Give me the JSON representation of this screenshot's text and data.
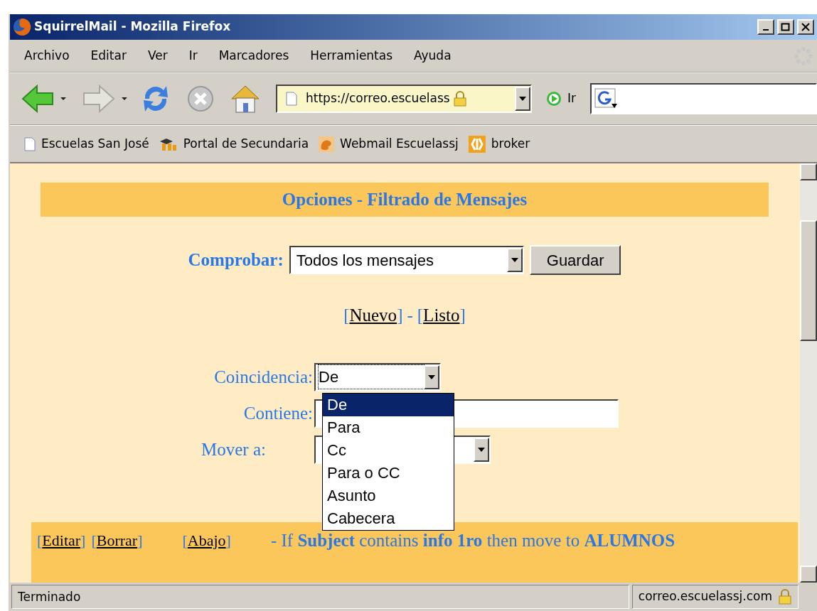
{
  "window": {
    "title": "SquirrelMail - Mozilla Firefox"
  },
  "menu": [
    "Archivo",
    "Editar",
    "Ver",
    "Ir",
    "Marcadores",
    "Herramientas",
    "Ayuda"
  ],
  "toolbar": {
    "url": "https://correo.escuelass",
    "go": "Ir"
  },
  "bookmarks": [
    {
      "label": "Escuelas San José",
      "kind": "page"
    },
    {
      "label": "Portal de Secundaria",
      "kind": "portal"
    },
    {
      "label": "Webmail Escuelassj",
      "kind": "webmail"
    },
    {
      "label": "broker",
      "kind": "broker"
    }
  ],
  "page": {
    "heading": "Opciones - Filtrado de Mensajes",
    "check": {
      "label": "Comprobar:",
      "value": "Todos los mensajes",
      "button": "Guardar"
    },
    "links": [
      {
        "open": "[",
        "label": "Nuevo",
        "close": "]"
      },
      {
        "open": "[",
        "label": "Listo",
        "close": "]"
      }
    ],
    "link_sep": "-",
    "form": {
      "match_label": "Coincidencia:",
      "match_value": "De",
      "contains_label": "Contiene:",
      "move_label": "Mover a:",
      "dropdown": [
        {
          "label": "De",
          "selected": true
        },
        {
          "label": "Para",
          "selected": false
        },
        {
          "label": "Cc",
          "selected": false
        },
        {
          "label": "Para o CC",
          "selected": false
        },
        {
          "label": "Asunto",
          "selected": false
        },
        {
          "label": "Cabecera",
          "selected": false
        }
      ]
    },
    "filters": [
      {
        "actions": [
          {
            "open": "[",
            "label": "Editar",
            "close": "]"
          },
          {
            "open": "[",
            "label": "Borrar",
            "close": "]"
          }
        ],
        "move": {
          "open": "[",
          "label": "Abajo",
          "close": "]"
        },
        "rule": "- If **Subject** contains **info 1ro** then move to **ALUMNOS**"
      }
    ]
  },
  "status_bar": {
    "text": "Terminado",
    "host": "correo.escuelassj.com"
  }
}
